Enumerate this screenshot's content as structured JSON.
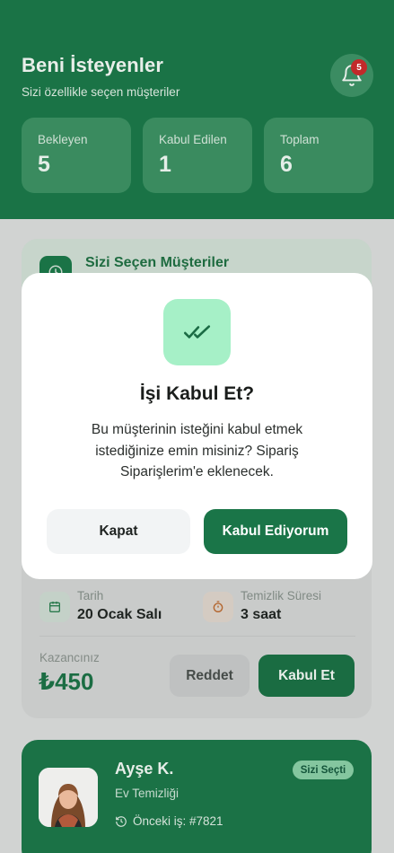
{
  "header": {
    "title": "Beni İsteyenler",
    "subtitle": "Sizi özellikle seçen müşteriler",
    "notification_count": "5"
  },
  "stats": [
    {
      "label": "Bekleyen",
      "value": "5"
    },
    {
      "label": "Kabul Edilen",
      "value": "1"
    },
    {
      "label": "Toplam",
      "value": "6"
    }
  ],
  "request_card": {
    "section_title": "Sizi Seçen Müşteriler",
    "date_label": "Tarih",
    "date_value": "20 Ocak Salı",
    "duration_label": "Temizlik Süresi",
    "duration_value": "3 saat",
    "earnings_label": "Kazancınız",
    "earnings_value": "₺450",
    "reject_label": "Reddet",
    "accept_label": "Kabul Et"
  },
  "customer_card": {
    "name": "Ayşe K.",
    "service": "Ev Temizliği",
    "previous_job": "Önceki iş: #7821",
    "tag": "Sizi Seçti"
  },
  "modal": {
    "title": "İşi Kabul Et?",
    "message": "Bu müşterinin isteğini kabul etmek istediğinize emin misiniz? Sipariş Siparişlerim'e eklenecek.",
    "close_label": "Kapat",
    "confirm_label": "Kabul Ediyorum"
  },
  "colors": {
    "brand_green": "#1a7346",
    "accent_mint": "#a6f0c7",
    "badge_red": "#c22a2a"
  },
  "icons": [
    "bell-icon",
    "clock-icon",
    "calendar-icon",
    "timer-icon",
    "history-icon",
    "double-check-icon"
  ]
}
